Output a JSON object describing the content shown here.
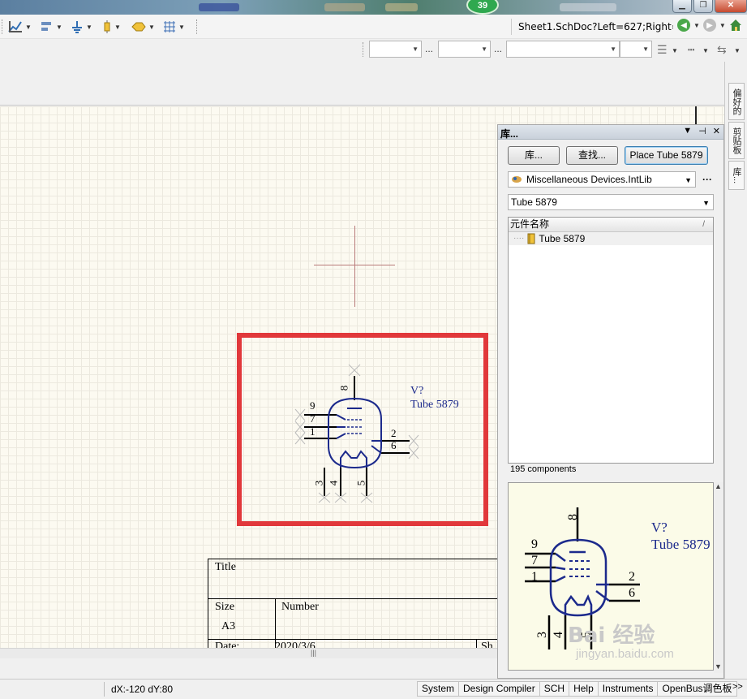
{
  "window": {
    "notification_count": "39",
    "controls": [
      "minimize",
      "restore",
      "close"
    ]
  },
  "toolbar": {
    "navigation_address": "Sheet1.SchDoc?Left=627;Right=",
    "icons": [
      "wiring-icon",
      "align-icon",
      "power-port-icon",
      "part-icon",
      "net-label-icon",
      "grid-icon"
    ]
  },
  "dock_tabs": [
    "偏好的",
    "剪贴板",
    "库..."
  ],
  "library_panel": {
    "title": "库...",
    "buttons": {
      "libraries": "库...",
      "search": "查找...",
      "place": "Place Tube 5879"
    },
    "library_selected": "Miscellaneous Devices.IntLib",
    "filter_value": "Tube 5879",
    "list_header": "元件名称",
    "list_items": [
      "Tube 5879"
    ],
    "component_count": "195 components"
  },
  "schematic": {
    "designator": "V?",
    "comment": "Tube 5879",
    "pins": [
      "8",
      "9",
      "7",
      "1",
      "2",
      "6",
      "3",
      "4",
      "5"
    ],
    "title_block": {
      "title_label": "Title",
      "size_label": "Size",
      "size_value": "A3",
      "number_label": "Number",
      "date_label": "Date:",
      "date_value": "2020/3/6",
      "sheet_label": "Sh"
    }
  },
  "status_bar": {
    "coordinates": "dX:-120 dY:80",
    "tabs": [
      "System",
      "Design Compiler",
      "SCH",
      "Help",
      "Instruments",
      "OpenBus调色板"
    ],
    "overflow": ">>"
  },
  "watermark": {
    "logo": "Bai 经验",
    "url": "jingyan.baidu.com"
  },
  "colors": {
    "highlight": "#e1383b",
    "schematic_blue": "#1c2a8c",
    "canvas": "#fcfaf1"
  }
}
